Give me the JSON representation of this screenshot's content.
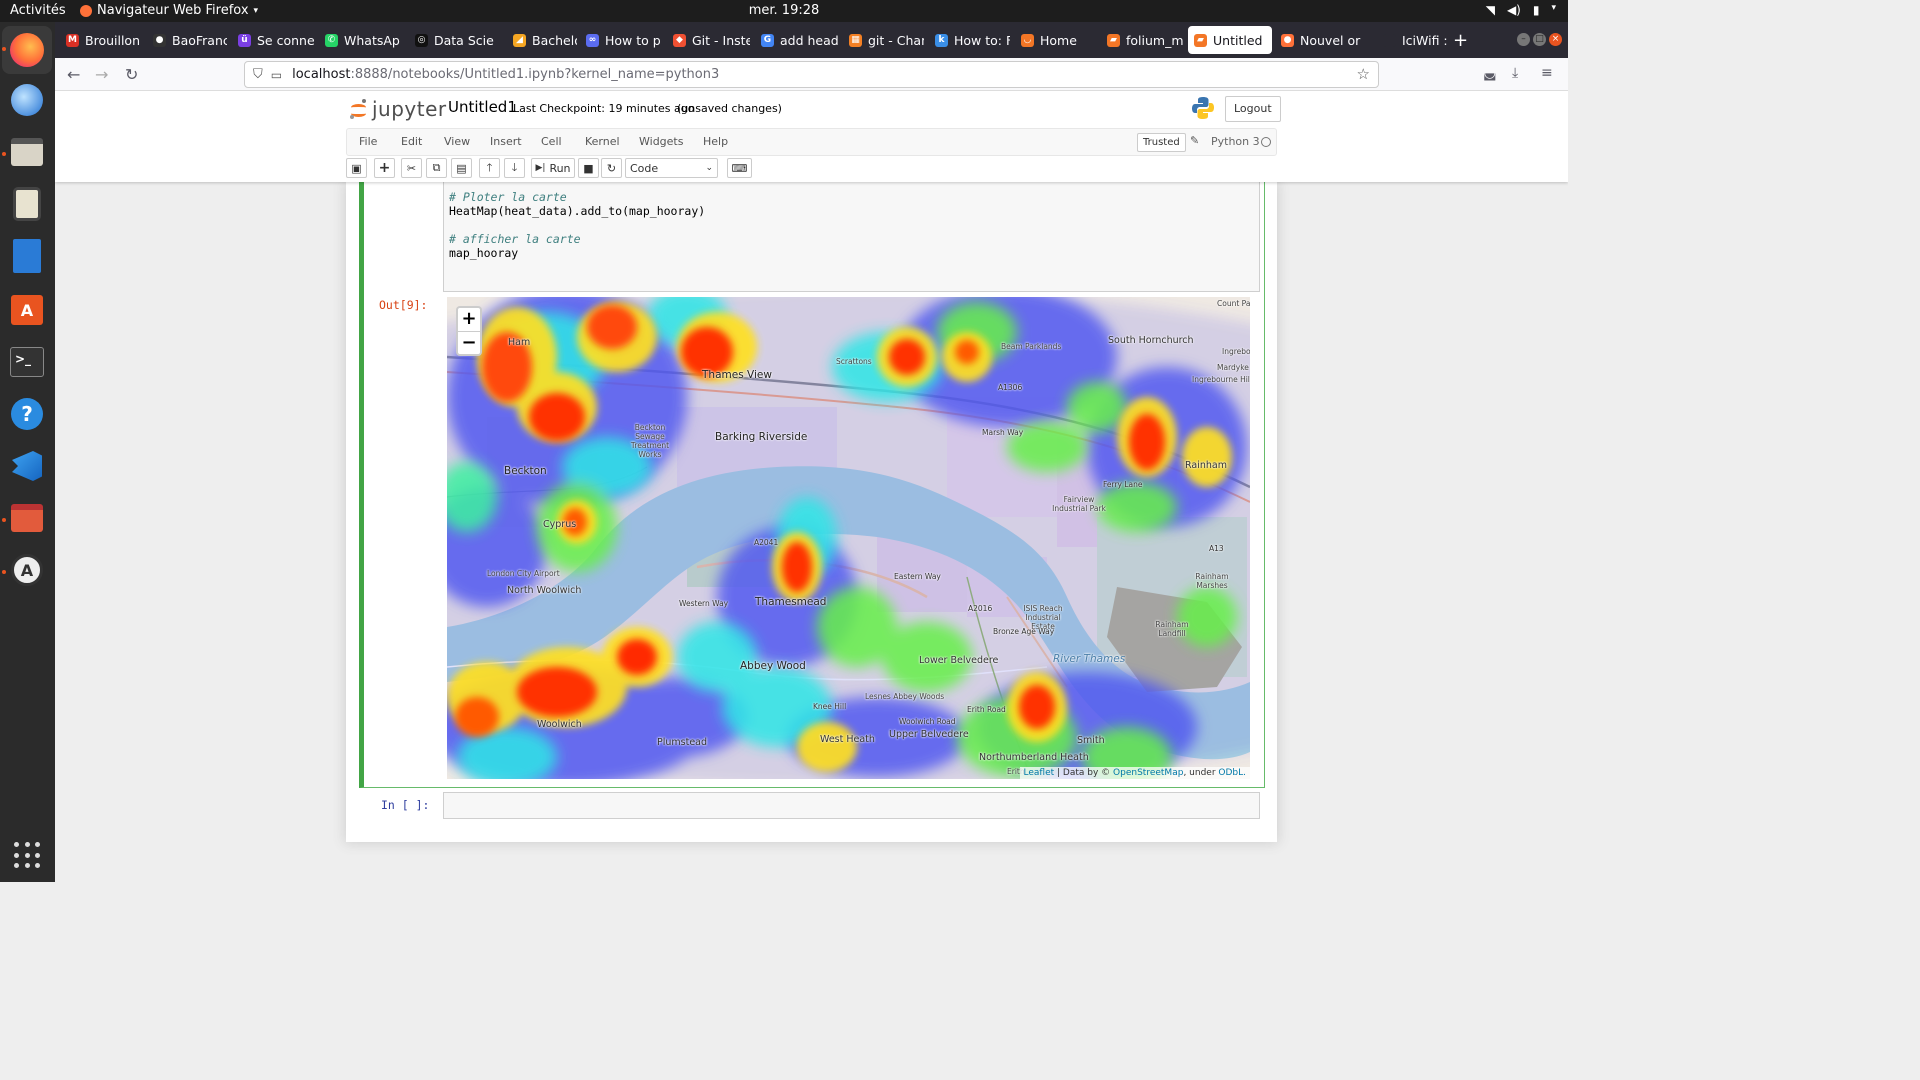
{
  "system": {
    "activities": "Activités",
    "app_name": "Navigateur Web Firefox",
    "clock": "mer. 19:28"
  },
  "browser": {
    "tabs": [
      {
        "label": "Brouillon",
        "favicon_color": "#d93025",
        "favicon_glyph": "M"
      },
      {
        "label": "BaoFranc",
        "favicon_color": "#333333",
        "favicon_glyph": "●"
      },
      {
        "label": "Se conne",
        "favicon_color": "#7b3fe4",
        "favicon_glyph": "ü"
      },
      {
        "label": "WhatsAp",
        "favicon_color": "#25d366",
        "favicon_glyph": "✆"
      },
      {
        "label": "Data Scie",
        "favicon_color": "#111111",
        "favicon_glyph": "◎"
      },
      {
        "label": "Bachelor",
        "favicon_color": "#f5a623",
        "favicon_glyph": "◢"
      },
      {
        "label": "How to p",
        "favicon_color": "#5b6cf0",
        "favicon_glyph": "∞"
      },
      {
        "label": "Git - Inste",
        "favicon_color": "#f05032",
        "favicon_glyph": "◆"
      },
      {
        "label": "add head",
        "favicon_color": "#4285f4",
        "favicon_glyph": "G"
      },
      {
        "label": "git - Chan",
        "favicon_color": "#f48024",
        "favicon_glyph": "▦"
      },
      {
        "label": "How to: F",
        "favicon_color": "#3a8ee6",
        "favicon_glyph": "k"
      },
      {
        "label": "Home",
        "favicon_color": "#f37626",
        "favicon_glyph": "◡"
      },
      {
        "label": "folium_m",
        "favicon_color": "#f37626",
        "favicon_glyph": "▰"
      },
      {
        "label": "Untitled",
        "favicon_color": "#f37626",
        "favicon_glyph": "▰",
        "active": true
      },
      {
        "label": "Nouvel or",
        "favicon_color": "#ff7139",
        "favicon_glyph": "●"
      },
      {
        "label": "IciWifi : s",
        "favicon_color": "#2b2a33",
        "favicon_glyph": ""
      }
    ],
    "url_host": "localhost",
    "url_rest": ":8888/notebooks/Untitled1.ipynb?kernel_name=python3"
  },
  "jupyter": {
    "logo_text": "jupyter",
    "notebook_title": "Untitled1",
    "checkpoint": "Last Checkpoint: 19 minutes ago",
    "unsaved": "(unsaved changes)",
    "logout": "Logout",
    "menus": [
      "File",
      "Edit",
      "View",
      "Insert",
      "Cell",
      "Kernel",
      "Widgets",
      "Help"
    ],
    "trusted": "Trusted",
    "kernel": "Python 3",
    "toolbar": {
      "run": "Run",
      "cell_type": "Code"
    },
    "code_lines": [
      {
        "text": "# Ploter la carte",
        "kind": "comment"
      },
      {
        "text": "HeatMap(heat_data).add_to(map_hooray)",
        "kind": "code"
      },
      {
        "text": "",
        "kind": "code"
      },
      {
        "text": "# afficher la carte",
        "kind": "comment"
      },
      {
        "text": "map_hooray",
        "kind": "code"
      }
    ],
    "out_prompt": "Out[9]:",
    "in_prompt": "In [ ]:"
  },
  "map": {
    "zoom_in": "+",
    "zoom_out": "−",
    "attribution": {
      "leaflet": "Leaflet",
      "sep": " | Data by © ",
      "osm": "OpenStreetMap",
      "under": ", under ",
      "odbl": "ODbL."
    },
    "place_labels": [
      "Barking Riverside",
      "Thames View",
      "Beckton",
      "Beckton Sewage Treatment Works",
      "Cyprus",
      "London City Airport",
      "North Woolwich",
      "Thamesmead",
      "Abbey Wood",
      "Lower Belvedere",
      "Upper Belvedere",
      "West Heath",
      "Plumstead",
      "Lesnes Abbey Woods",
      "Northumberland Heath",
      "South Hornchurch",
      "Rainham",
      "Rainham Marshes",
      "Rainham Landfill",
      "Fairview Industrial Park",
      "ISIS Reach Industrial Estate",
      "River Thames",
      "Beam Parklands",
      "Scrattons",
      "A1306",
      "A13",
      "A2016",
      "A2041",
      "Western Way",
      "Eastern Way",
      "Marsh Way",
      "Ferry Lane",
      "Ingrebourne Hill",
      "Woolwich Road",
      "Knee Hill",
      "Erith Road",
      "Bronze Age Way",
      "Ham",
      "Woolwich",
      "Smith",
      "Count Park",
      "Ingrebourne",
      "Mardyke",
      "Erith"
    ]
  }
}
